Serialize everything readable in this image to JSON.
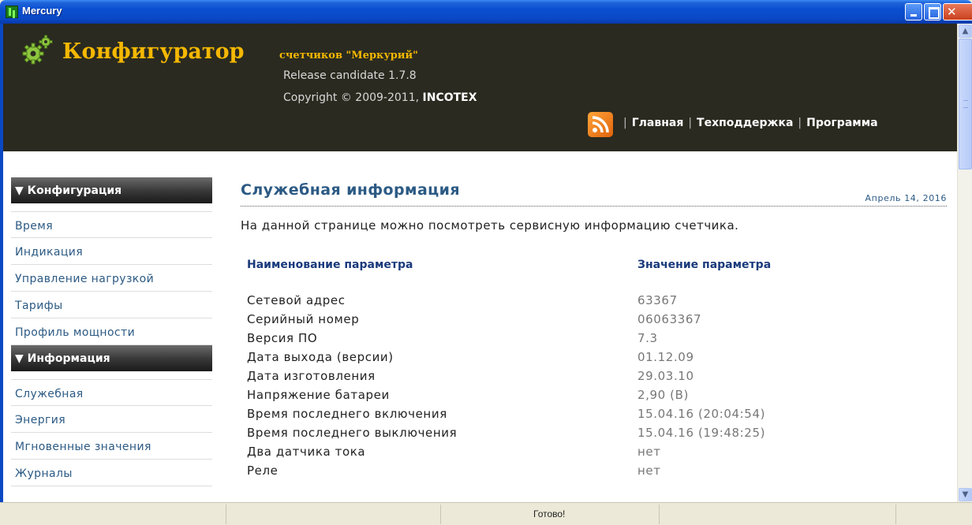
{
  "window": {
    "title": "Mercury"
  },
  "header": {
    "brand": "Конфигуратор",
    "sub_brand": "счетчиков \"Меркурий\"",
    "release": "Release candidate 1.7.8",
    "copyright_prefix": "Copyright © 2009-2011, ",
    "copyright_company": "INCOTEX",
    "nav": [
      {
        "label": "Главная"
      },
      {
        "label": "Техподдержка"
      },
      {
        "label": "Программа"
      }
    ],
    "separator": "|"
  },
  "sidebar": {
    "sections": [
      {
        "title": "▼ Конфигурация",
        "items": [
          "Время",
          "Индикация",
          "Управление нагрузкой",
          "Тарифы",
          "Профиль мощности"
        ]
      },
      {
        "title": "▼ Информация",
        "items": [
          "Служебная",
          "Энергия",
          "Мгновенные значения",
          "Журналы"
        ]
      }
    ]
  },
  "main": {
    "title": "Служебная информация",
    "date": "Апрель 14, 2016",
    "intro": "На данной странице можно посмотреть сервисную информацию счетчика.",
    "table": {
      "headers": [
        "Наименование параметра",
        "Значение параметра"
      ],
      "rows": [
        [
          "Сетевой адрес",
          "63367"
        ],
        [
          "Серийный номер",
          "06063367"
        ],
        [
          "Версия ПО",
          "7.3"
        ],
        [
          "Дата выхода (версии)",
          "01.12.09"
        ],
        [
          "Дата изготовления",
          "29.03.10"
        ],
        [
          "Напряжение батареи",
          "2,90 (В)"
        ],
        [
          "Время последнего включения",
          "15.04.16 (20:04:54)"
        ],
        [
          "Время последнего выключения",
          "15.04.16 (19:48:25)"
        ],
        [
          "Два датчика тока",
          "нет"
        ],
        [
          "Реле",
          "нет"
        ]
      ]
    }
  },
  "statusbar": {
    "text": "Готово!"
  },
  "colors": {
    "header_bg": "#2a2a20",
    "brand": "#f5b800",
    "link": "#2c5a84",
    "titlebar": "#0a48c4"
  }
}
